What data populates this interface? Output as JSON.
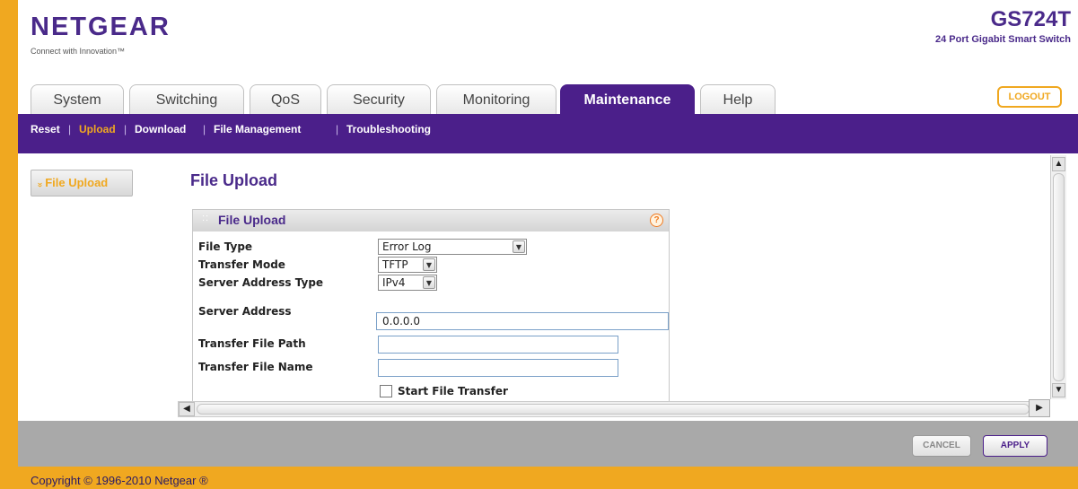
{
  "brand": {
    "logo": "NETGEAR",
    "tagline": "Connect with Innovation™",
    "model": "GS724T",
    "model_desc": "24 Port Gigabit Smart Switch"
  },
  "tabs": [
    {
      "label": "System"
    },
    {
      "label": "Switching"
    },
    {
      "label": "QoS"
    },
    {
      "label": "Security"
    },
    {
      "label": "Monitoring"
    },
    {
      "label": "Maintenance",
      "active": true
    },
    {
      "label": "Help"
    }
  ],
  "logout_label": "LOGOUT",
  "subnav": [
    {
      "label": "Reset"
    },
    {
      "label": "Upload",
      "active": true
    },
    {
      "label": "Download"
    },
    {
      "label": "File Management"
    },
    {
      "label": "Troubleshooting"
    }
  ],
  "side_button": "File Upload",
  "side_button_arrow": "»",
  "page_title": "File Upload",
  "form": {
    "header_title": "File Upload",
    "help_glyph": "?",
    "file_type_label": "File Type",
    "file_type_value": "Error Log",
    "transfer_mode_label": "Transfer Mode",
    "transfer_mode_value": "TFTP",
    "server_address_type_label": "Server Address Type",
    "server_address_type_value": "IPv4",
    "server_address_label": "Server Address",
    "server_address_value": "0.0.0.0",
    "transfer_file_path_label": "Transfer File Path",
    "transfer_file_path_value": "",
    "transfer_file_name_label": "Transfer File Name",
    "transfer_file_name_value": "",
    "start_transfer_label": "Start File Transfer",
    "start_transfer_checked": false
  },
  "buttons": {
    "cancel": "CANCEL",
    "apply": "APPLY"
  },
  "copyright": "Copyright © 1996-2010 Netgear ®",
  "colors": {
    "brand_purple": "#4b1f8a",
    "accent_orange": "#f0a820",
    "footer_gray": "#a9a9a9"
  }
}
